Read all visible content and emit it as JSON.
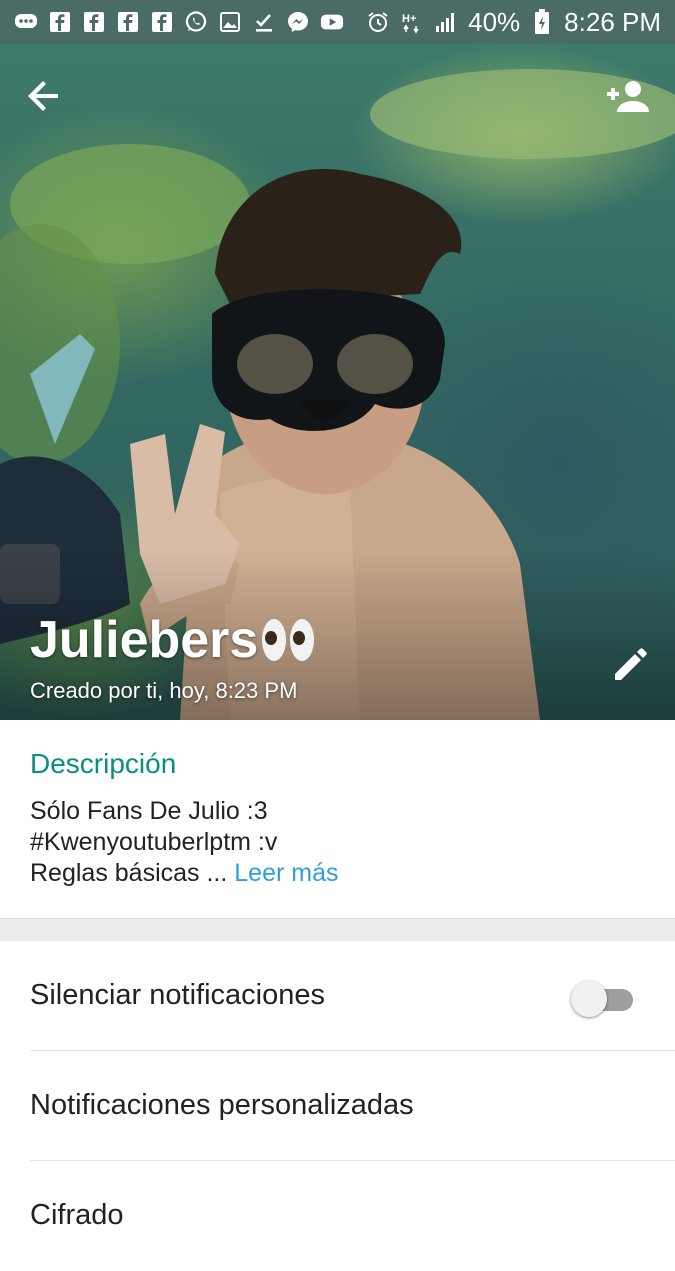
{
  "status_bar": {
    "left_icons": [
      "messages-icon",
      "facebook-icon",
      "facebook-icon",
      "facebook-icon",
      "facebook-icon",
      "whatsapp-icon",
      "gallery-icon",
      "download-done-icon",
      "messenger-icon",
      "youtube-icon"
    ],
    "right_icons": [
      "alarm-icon",
      "data-h-plus-icon",
      "signal-icon",
      "battery-charging-icon"
    ],
    "battery": "40%",
    "time": "8:26 PM"
  },
  "header": {
    "group_name": "Juliebers",
    "created_text": "Creado por ti, hoy, 8:23 PM"
  },
  "description": {
    "title": "Descripción",
    "line1": "Sólo Fans De Julio :3",
    "line2": "#Kwenyoutuberlptm :v",
    "line3": "Reglas básicas ...",
    "read_more": "Leer más"
  },
  "settings": {
    "mute_label": "Silenciar notificaciones",
    "custom_label": "Notificaciones personalizadas",
    "encryption_label": "Cifrado"
  },
  "colors": {
    "accent": "#0a8f7f",
    "link": "#2f9ee0",
    "status_bar": "#4a6b66"
  }
}
